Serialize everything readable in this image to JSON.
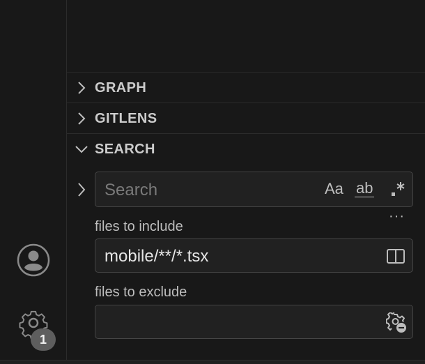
{
  "activity_bar": {
    "account_icon": "account-icon",
    "manage_icon": "gear-icon",
    "manage_badge": "1"
  },
  "panes": [
    {
      "title": "GRAPH",
      "expanded": false
    },
    {
      "title": "GITLENS",
      "expanded": false
    },
    {
      "title": "SEARCH",
      "expanded": true
    }
  ],
  "search": {
    "placeholder": "Search",
    "value": "",
    "options": {
      "match_case": "Aa",
      "whole_word": "ab",
      "regex": ".*"
    },
    "more_label": "···",
    "include": {
      "label": "files to include",
      "value": "mobile/**/*.tsx",
      "icon": "book-icon"
    },
    "exclude": {
      "label": "files to exclude",
      "value": "",
      "icon": "settings-exclude-icon"
    }
  },
  "colors": {
    "background": "#181818",
    "border": "#2b2b2b",
    "input_bg": "#212121",
    "input_border": "#454545",
    "badge_bg": "#5e5e5e"
  }
}
